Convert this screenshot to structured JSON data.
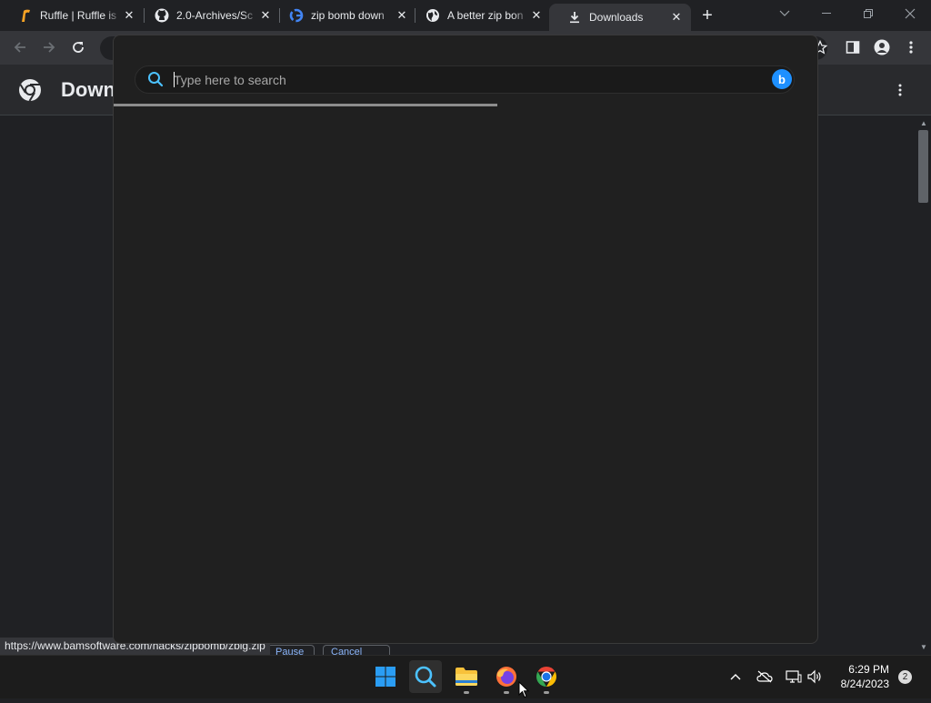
{
  "browser": {
    "tabs": [
      {
        "title": "Ruffle | Ruffle is",
        "favicon": "ruffle-icon",
        "active": false
      },
      {
        "title": "2.0-Archives/Sc",
        "favicon": "github-icon",
        "active": false
      },
      {
        "title": "zip bomb down",
        "favicon": "google-icon",
        "active": false
      },
      {
        "title": "A better zip bon",
        "favicon": "globe-icon",
        "active": false
      },
      {
        "title": "Downloads",
        "favicon": "download-icon",
        "active": true
      }
    ],
    "new_tab_glyph": "+",
    "page_title": "Down",
    "status_url": "https://www.bamsoftware.com/hacks/zipbomb/zblg.zip",
    "partial_buttons": [
      "Pause",
      "Cancel"
    ]
  },
  "search_flyout": {
    "input_value": "",
    "placeholder": "Type here to search",
    "progress_fraction": 0.545,
    "bing_glyph": "b"
  },
  "taskbar": {
    "apps": [
      {
        "name": "start-icon",
        "running": false
      },
      {
        "name": "search-icon",
        "running": false,
        "active": true
      },
      {
        "name": "file-explorer-icon",
        "running": true
      },
      {
        "name": "firefox-icon",
        "running": true
      },
      {
        "name": "chrome-icon",
        "running": true
      }
    ],
    "time": "6:29 PM",
    "date": "8/24/2023",
    "notification_count": "2"
  },
  "colors": {
    "accent_blue": "#1e90ff",
    "chrome_dark": "#202124",
    "toolbar": "#35363a"
  }
}
